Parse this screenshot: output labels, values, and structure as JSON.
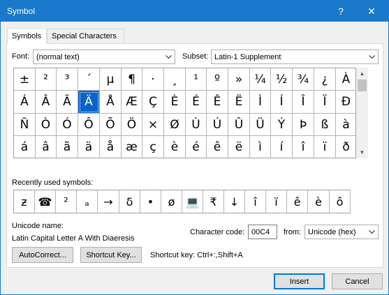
{
  "window": {
    "title": "Symbol",
    "help_glyph": "?",
    "close_glyph": "✕"
  },
  "tabs": [
    {
      "label": "Symbols",
      "active": true
    },
    {
      "label": "Special Characters",
      "active": false
    }
  ],
  "font": {
    "label": "Font:",
    "value": "(normal text)"
  },
  "subset": {
    "label": "Subset:",
    "value": "Latin-1 Supplement"
  },
  "symbols": [
    [
      "±",
      "²",
      "³",
      "´",
      "µ",
      "¶",
      "·",
      "¸",
      "¹",
      "º",
      "»",
      "¼",
      "½",
      "¾",
      "¿",
      "À"
    ],
    [
      "Á",
      "Â",
      "Ã",
      "Ä",
      "Å",
      "Æ",
      "Ç",
      "È",
      "É",
      "Ê",
      "Ë",
      "Ì",
      "Í",
      "Î",
      "Ï",
      "Ð"
    ],
    [
      "Ñ",
      "Ò",
      "Ó",
      "Ô",
      "Õ",
      "Ö",
      "×",
      "Ø",
      "Ù",
      "Ú",
      "Û",
      "Ü",
      "Ý",
      "Þ",
      "ß",
      "à"
    ],
    [
      "á",
      "â",
      "ã",
      "ä",
      "å",
      "æ",
      "ç",
      "è",
      "é",
      "ê",
      "ë",
      "ì",
      "í",
      "î",
      "ï",
      "ð"
    ]
  ],
  "selected_symbol": "Ä",
  "recent": {
    "label": "Recently used symbols:",
    "items": [
      "ƶ",
      "☎",
      "²",
      "ₐ",
      "→",
      "δ",
      "•",
      "ø",
      "💻",
      "₹",
      "↓",
      "î",
      "ï",
      "ê",
      "è",
      "ô"
    ]
  },
  "unicode": {
    "name_label": "Unicode name:",
    "name_value": "Latin Capital Letter A With Diaeresis",
    "code_label": "Character code:",
    "code_value": "00C4",
    "from_label": "from:",
    "from_value": "Unicode (hex)"
  },
  "buttons": {
    "autocorrect": "AutoCorrect...",
    "shortcut_key": "Shortcut Key...",
    "shortcut_text": "Shortcut key: Ctrl+:,Shift+A",
    "insert": "Insert",
    "cancel": "Cancel"
  },
  "colors": {
    "title_bar": "#1979ca",
    "selection": "#0a64c8"
  }
}
